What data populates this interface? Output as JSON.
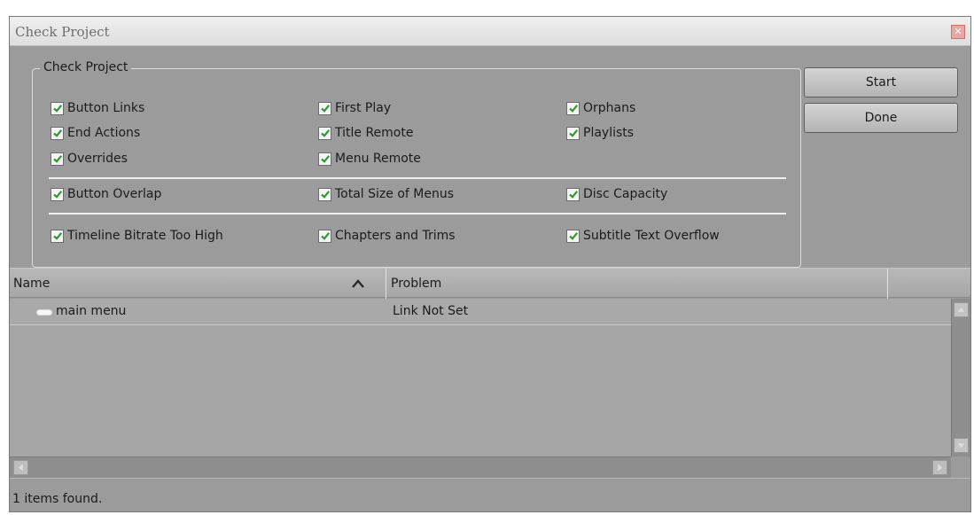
{
  "window": {
    "title": "Check Project"
  },
  "group": {
    "label": "Check Project",
    "checks": [
      {
        "label": "Button Links",
        "checked": true
      },
      {
        "label": "End Actions",
        "checked": true
      },
      {
        "label": "Overrides",
        "checked": true
      },
      {
        "label": "First Play",
        "checked": true
      },
      {
        "label": "Title Remote",
        "checked": true
      },
      {
        "label": "Menu Remote",
        "checked": true
      },
      {
        "label": "Orphans",
        "checked": true
      },
      {
        "label": "Playlists",
        "checked": true
      },
      {
        "label": "Button Overlap",
        "checked": true
      },
      {
        "label": "Total Size of Menus",
        "checked": true
      },
      {
        "label": "Disc Capacity",
        "checked": true
      },
      {
        "label": "Timeline Bitrate Too High",
        "checked": true
      },
      {
        "label": "Chapters and Trims",
        "checked": true
      },
      {
        "label": "Subtitle Text Overflow",
        "checked": true
      }
    ]
  },
  "buttons": {
    "start": "Start",
    "done": "Done"
  },
  "table": {
    "columns": [
      "Name",
      "Problem"
    ],
    "rows": [
      {
        "name": "main menu",
        "problem": "Link Not Set"
      }
    ]
  },
  "status": {
    "text": "1 items found."
  },
  "colors": {
    "dialog_bg": "#9b9b9b",
    "check_mark": "#2c9a2c"
  }
}
